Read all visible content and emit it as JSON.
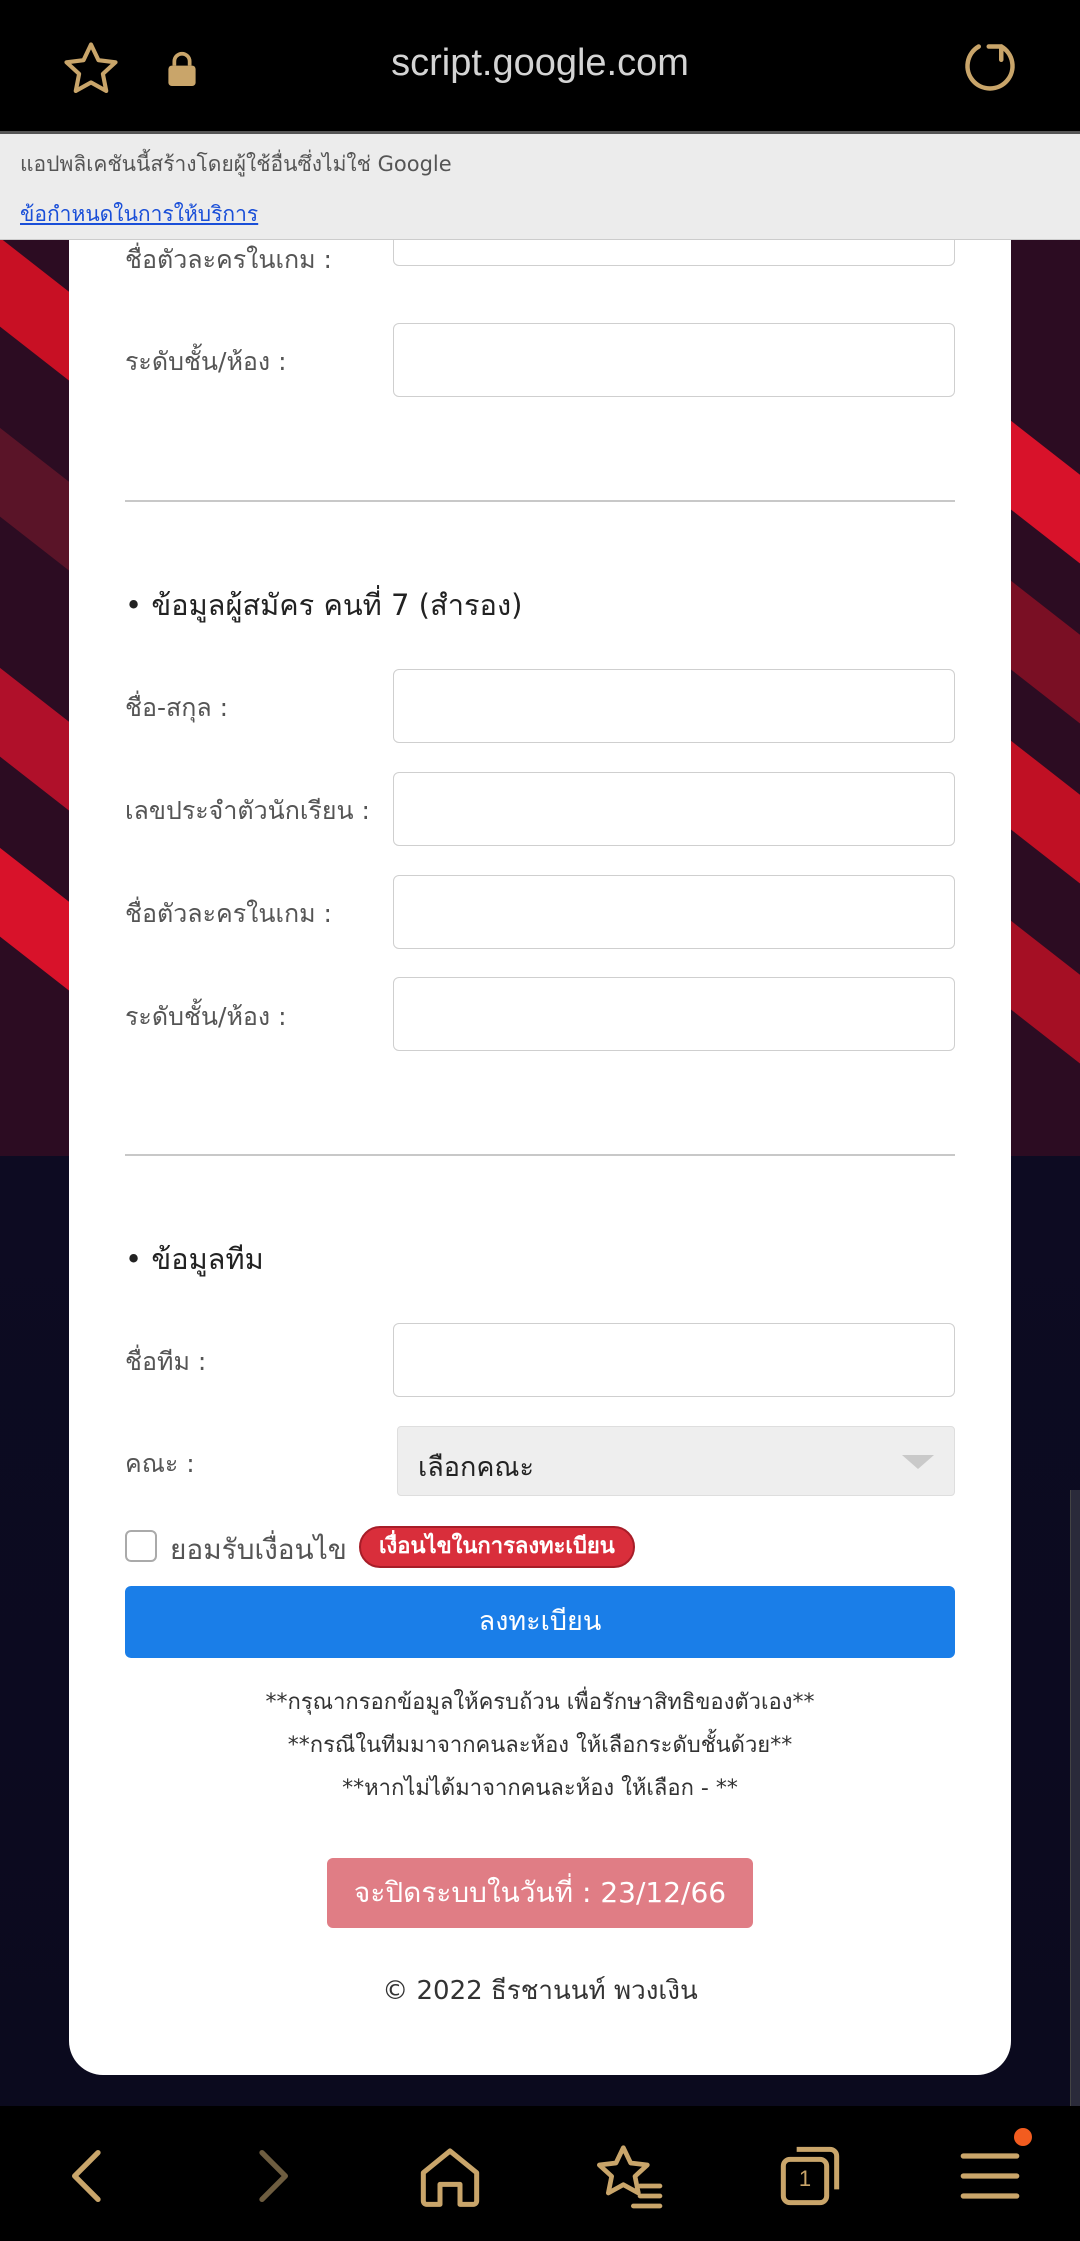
{
  "browser": {
    "url": "script.google.com"
  },
  "notice": {
    "message": "แอปพลิเคชันนี้สร้างโดยผู้ใช้อื่นซึ่งไม่ใช่ Google",
    "terms_link": "ข้อกำหนดในการให้บริการ"
  },
  "form": {
    "member6": {
      "ign_label": "ชื่อตัวละครในเกม :",
      "class_label": "ระดับชั้น/ห้อง :"
    },
    "member7": {
      "title": "• ข้อมูลผู้สมัคร คนที่ 7 (สำรอง)",
      "name_label": "ชื่อ-สกุล :",
      "student_id_label": "เลขประจำตัวนักเรียน :",
      "ign_label": "ชื่อตัวละครในเกม :",
      "class_label": "ระดับชั้น/ห้อง :"
    },
    "team": {
      "title": "• ข้อมูลทีม",
      "team_name_label": "ชื่อทีม :",
      "faculty_label": "คณะ :",
      "faculty_selected": "เลือกคณะ"
    },
    "accept_label": "ยอมรับเงื่อนไข",
    "conditions_badge": "เงื่อนไขในการลงทะเบียน",
    "submit_label": "ลงทะเบียน",
    "notes": [
      "**กรุณากรอกข้อมูลให้ครบถ้วน เพื่อรักษาสิทธิของตัวเอง**",
      "**กรณีในทีมมาจากคนละห้อง ให้เลือกระดับชั้นด้วย**",
      "**หากไม่ได้มาจากคนละห้อง ให้เลือก - **"
    ],
    "close_notice": "จะปิดระบบในวันที่ : 23/12/66",
    "copyright": "© 2022 ธีรชานนท์ พวงเงิน"
  },
  "bottom_nav": {
    "tab_count": "1",
    "items": [
      "back-icon",
      "forward-icon",
      "home-icon",
      "bookmarks-icon",
      "tabs-icon",
      "menu-icon"
    ]
  },
  "colors": {
    "accent_gold": "#c9a56a",
    "submit_blue": "#1a7ee8",
    "badge_red": "#d92e3b",
    "close_pink": "#e07d85"
  }
}
